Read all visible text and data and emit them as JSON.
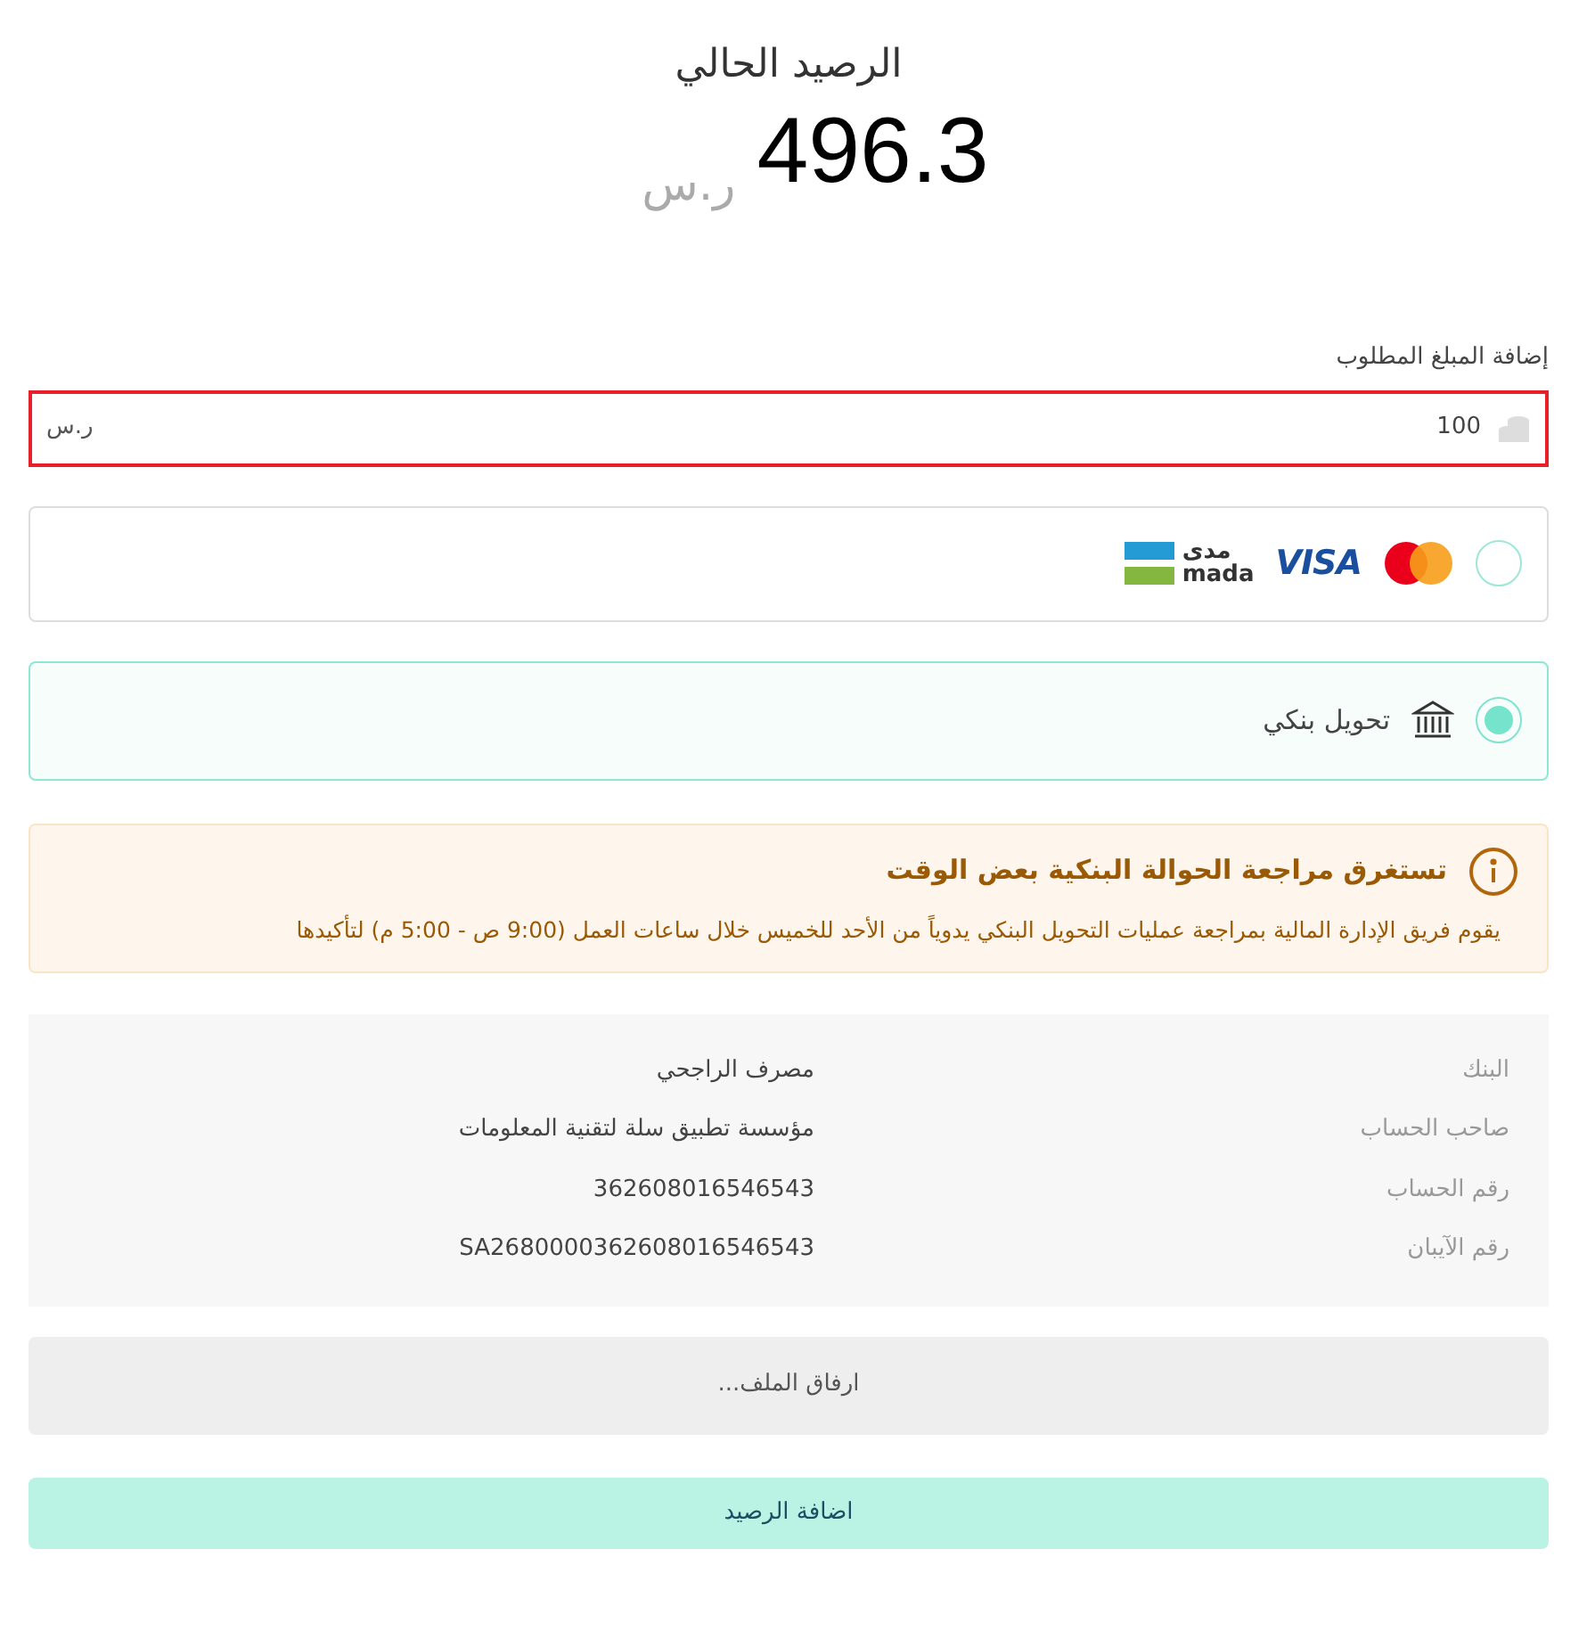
{
  "balance": {
    "title": "الرصيد الحالي",
    "amount": "496.3",
    "currency": "ر.س"
  },
  "amount_field": {
    "label": "إضافة المبلغ المطلوب",
    "value": "100",
    "currency": "ر.س",
    "invalid": true
  },
  "payment_methods": [
    {
      "kind": "card",
      "selected": false,
      "visa": "VISA",
      "mada_arabic": "مدى",
      "mada_latin": "mada"
    },
    {
      "kind": "bank",
      "selected": true,
      "label": "تحويل بنكي"
    }
  ],
  "notice": {
    "title": "تستغرق مراجعة الحوالة البنكية بعض الوقت",
    "text": "يقوم فريق الإدارة المالية بمراجعة عمليات التحويل البنكي يدوياً من الأحد للخميس خلال ساعات العمل (9:00 ص - 5:00 م) لتأكيدها"
  },
  "bank_details": [
    {
      "label": "البنك",
      "value": "مصرف الراجحي"
    },
    {
      "label": "صاحب الحساب",
      "value": "مؤسسة تطبيق سلة لتقنية المعلومات"
    },
    {
      "label": "رقم الحساب",
      "value": "362608016546543"
    },
    {
      "label": "رقم الآيبان",
      "value": "SA2680000362608016546543"
    }
  ],
  "attach_button": "ارفاق الملف...",
  "submit_button": "اضافة الرصيد"
}
